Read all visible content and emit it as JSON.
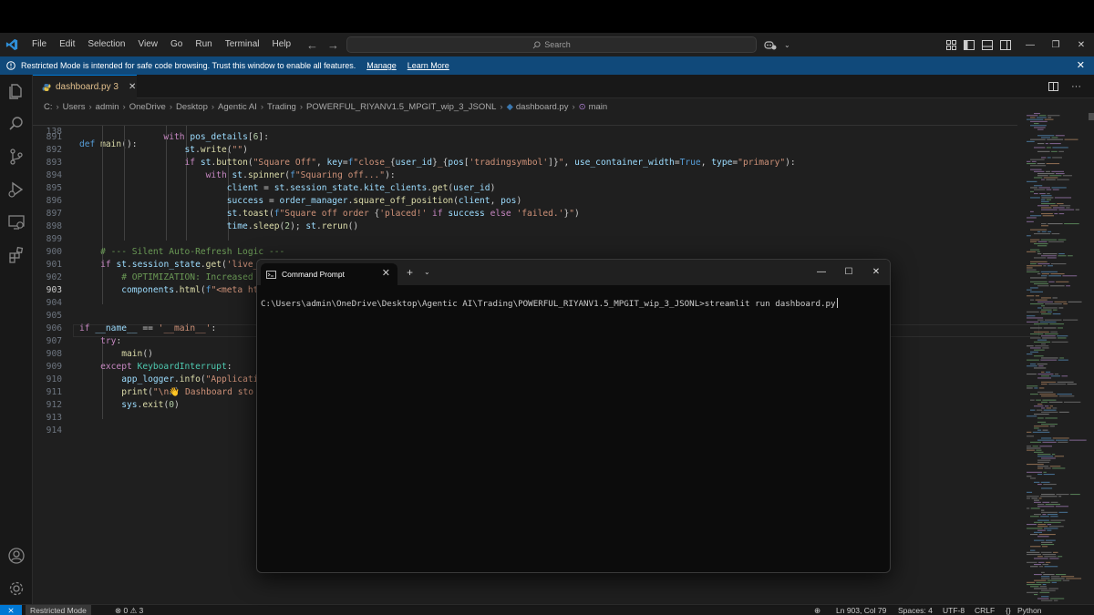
{
  "titlebar": {
    "menu": [
      "File",
      "Edit",
      "Selection",
      "View",
      "Go",
      "Run",
      "Terminal",
      "Help"
    ],
    "search_placeholder": "Search"
  },
  "banner": {
    "message": "Restricted Mode is intended for safe code browsing. Trust this window to enable all features.",
    "manage": "Manage",
    "learn_more": "Learn More"
  },
  "editor": {
    "tab_label": "dashboard.py 3",
    "breadcrumb": [
      "C:",
      "Users",
      "admin",
      "OneDrive",
      "Desktop",
      "Agentic AI",
      "Trading",
      "POWERFUL_RIYANV1.5_MPGIT_wip_3_JSONL",
      "dashboard.py",
      "main"
    ],
    "sticky_line": {
      "num": "138",
      "text": "def main():"
    },
    "line_numbers": [
      "891",
      "892",
      "893",
      "894",
      "895",
      "896",
      "897",
      "898",
      "899",
      "900",
      "901",
      "902",
      "903",
      "904",
      "905",
      "906",
      "907",
      "908",
      "909",
      "910",
      "911",
      "912",
      "913",
      "914"
    ],
    "active_line": "903"
  },
  "terminal": {
    "title": "Command Prompt",
    "command_line": "C:\\Users\\admin\\OneDrive\\Desktop\\Agentic AI\\Trading\\POWERFUL_RIYANV1.5_MPGIT_wip_3_JSONL>streamlit run dashboard.py"
  },
  "statusbar": {
    "restricted": "Restricted Mode",
    "problems": "⊗ 0 ⚠ 3",
    "position": "Ln 903, Col 79",
    "spaces": "Spaces: 4",
    "encoding": "UTF-8",
    "eol": "CRLF",
    "language": "Python"
  },
  "colors": {
    "accent": "#0078d4",
    "banner": "#10497a",
    "modified_tab": "#e2c08d"
  }
}
